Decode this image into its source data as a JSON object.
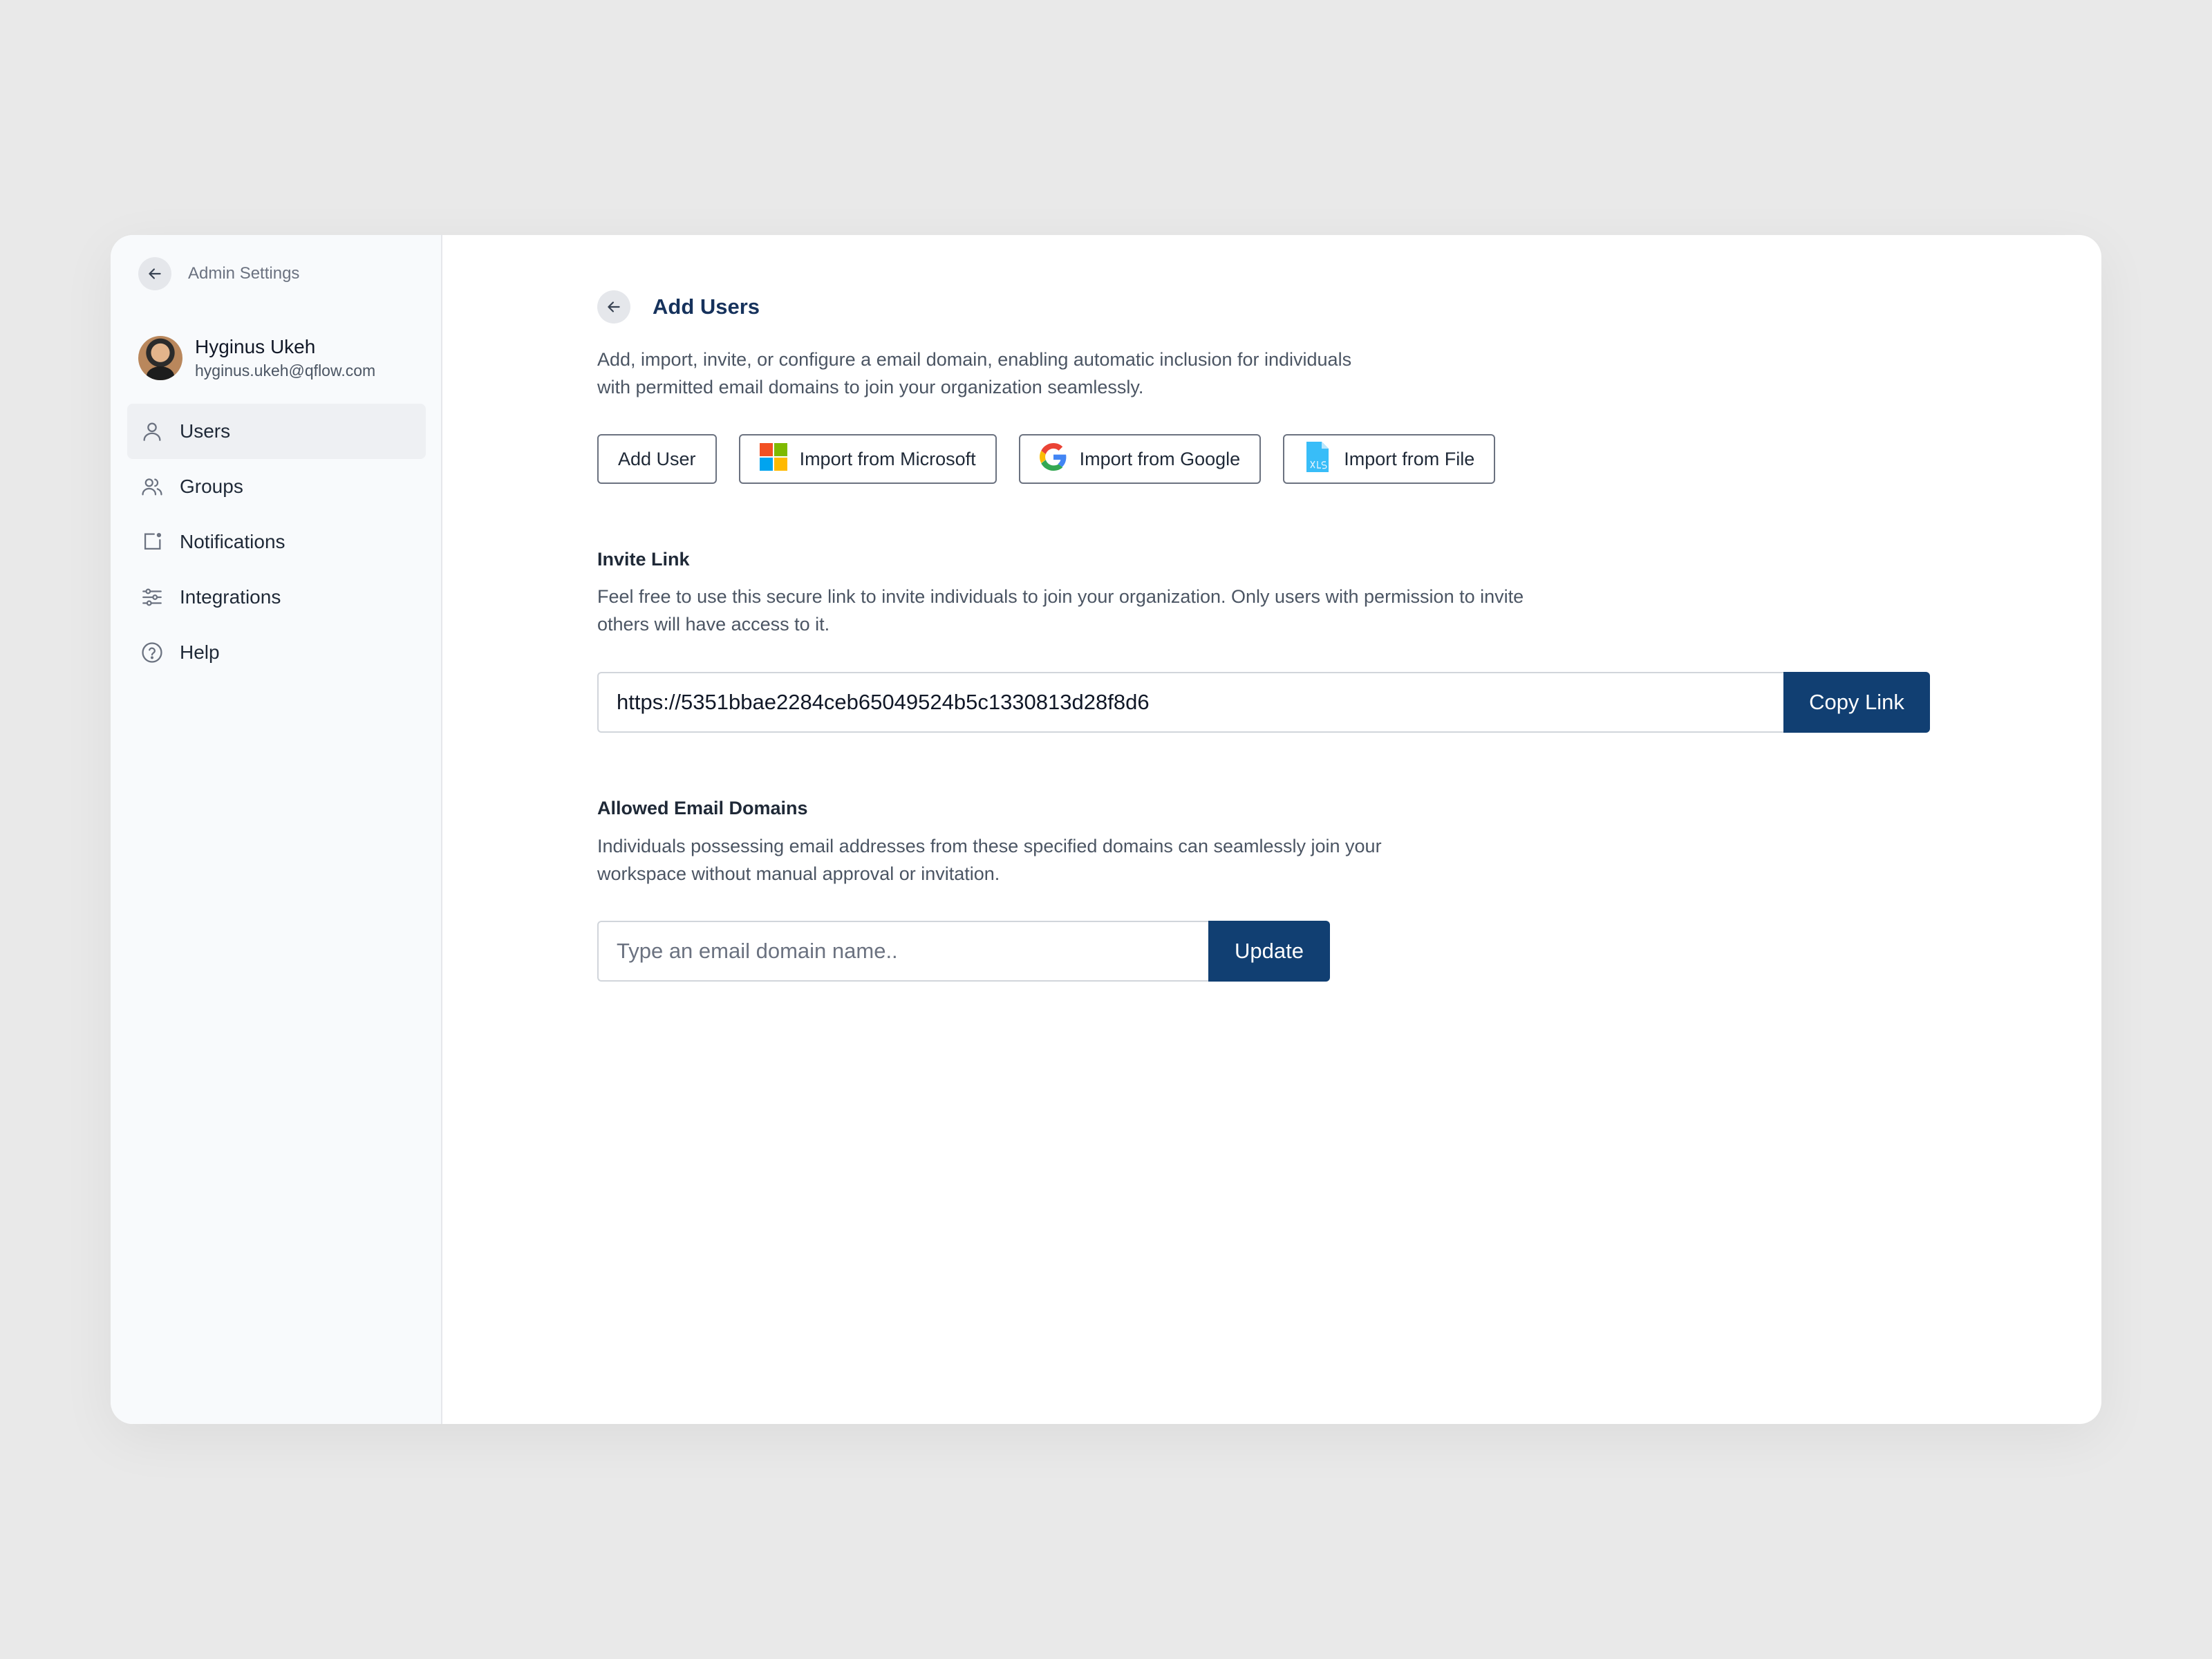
{
  "sidebar": {
    "back_label": "Admin Settings",
    "user": {
      "name": "Hyginus Ukeh",
      "email": "hyginus.ukeh@qflow.com"
    },
    "items": [
      {
        "label": "Users",
        "icon": "user-icon",
        "active": true
      },
      {
        "label": "Groups",
        "icon": "groups-icon",
        "active": false
      },
      {
        "label": "Notifications",
        "icon": "notification-icon",
        "active": false
      },
      {
        "label": "Integrations",
        "icon": "sliders-icon",
        "active": false
      },
      {
        "label": "Help",
        "icon": "help-icon",
        "active": false
      }
    ]
  },
  "main": {
    "title": "Add Users",
    "description": "Add, import, invite, or configure a email domain, enabling automatic inclusion for individuals with permitted email domains to join your organization seamlessly.",
    "buttons": {
      "add_user": "Add User",
      "import_microsoft": "Import from Microsoft",
      "import_google": "Import from Google",
      "import_file": "Import from File"
    },
    "invite": {
      "title": "Invite Link",
      "description": "Feel free to use this secure link to invite individuals to join your organization. Only users with permission to invite others will have access to it.",
      "link": "https://5351bbae2284ceb65049524b5c1330813d28f8d6",
      "copy_label": "Copy Link"
    },
    "domains": {
      "title": "Allowed Email Domains",
      "description": "Individuals possessing email addresses from these specified domains can seamlessly join your workspace without manual approval or invitation.",
      "placeholder": "Type an email domain name..",
      "value": "",
      "update_label": "Update"
    }
  },
  "colors": {
    "primary": "#113f72",
    "title": "#16325c",
    "background": "#e9e9e9",
    "sidebar_bg": "#f8fafc"
  }
}
